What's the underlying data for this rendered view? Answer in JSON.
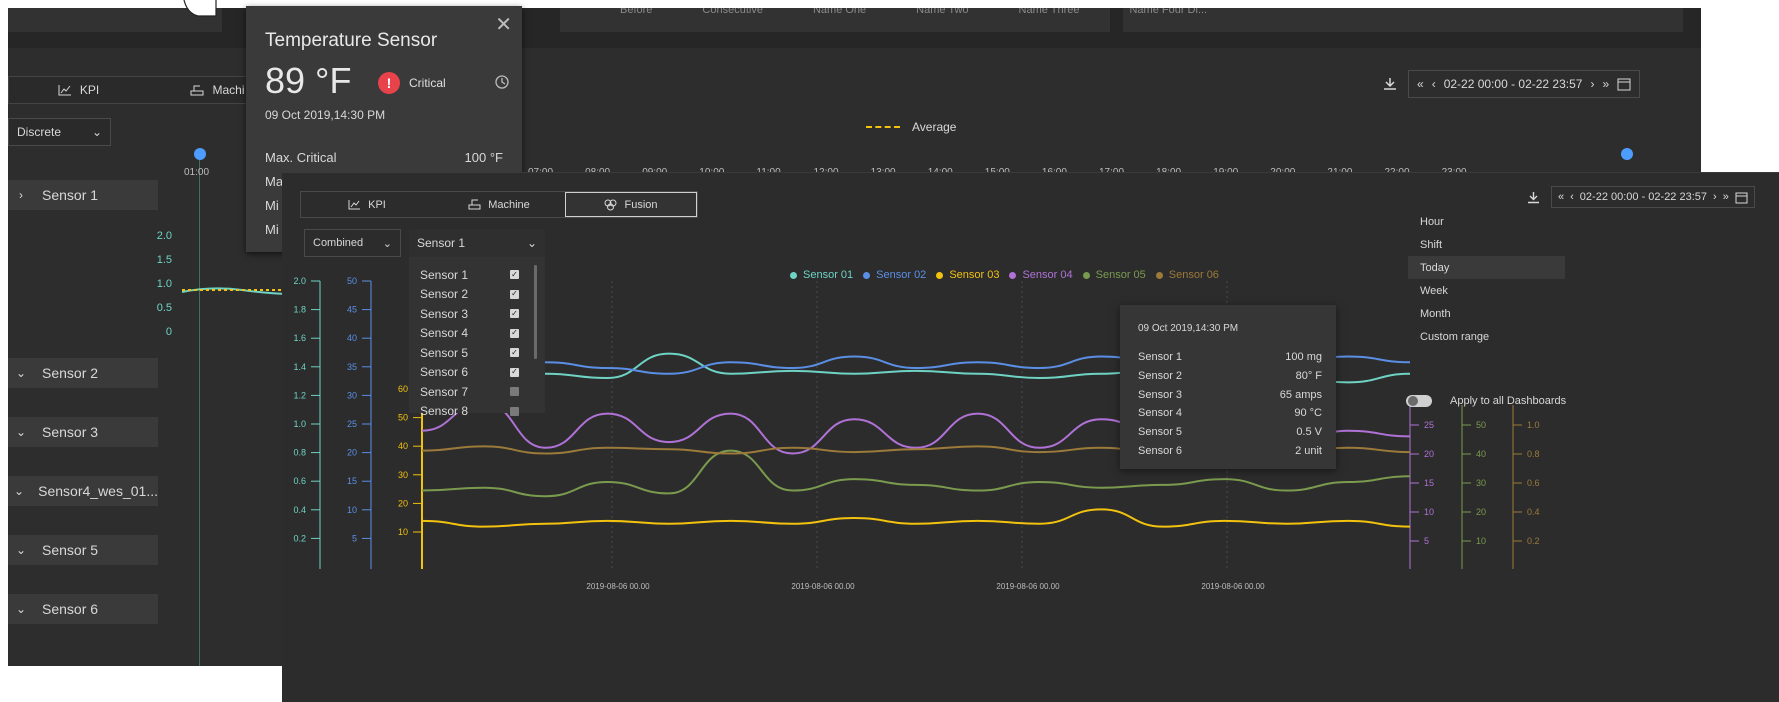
{
  "background_window": {
    "table_columns": [
      "Before",
      "Consecutive",
      "Name One",
      "Name Two",
      "Name Three",
      "Name Four Di..."
    ],
    "tabs": [
      {
        "label": "KPI"
      },
      {
        "label": "Machi"
      }
    ],
    "mode_select": "Discrete",
    "legend_average": "Average",
    "date_range": "02-22  00:00 - 02-22  23:57",
    "time_ticks": [
      "01:00",
      "07:00",
      "08:00",
      "09:00",
      "10:00",
      "11:00",
      "12:00",
      "13:00",
      "14:00",
      "15:00",
      "16:00",
      "17:00",
      "18:00",
      "19:00",
      "20:00",
      "21:00",
      "22:00",
      "23:00"
    ],
    "y_ticks": [
      "2.0",
      "1.5",
      "1.0",
      "0.5",
      "0"
    ],
    "sensors": [
      "Sensor 1",
      "Sensor 2",
      "Sensor 3",
      "Sensor4_wes_01...",
      "Sensor 5",
      "Sensor 6"
    ]
  },
  "temperature_card": {
    "title": "Temperature Sensor",
    "value": "89 °F",
    "status": "Critical",
    "timestamp": "09 Oct 2019,14:30 PM",
    "rows": [
      {
        "label": "Max. Critical",
        "value": "100 °F"
      },
      {
        "label": "Ma",
        "value": ""
      },
      {
        "label": "Mi",
        "value": ""
      },
      {
        "label": "Mi",
        "value": ""
      }
    ]
  },
  "front_window": {
    "tabs": [
      {
        "label": "KPI"
      },
      {
        "label": "Machine"
      },
      {
        "label": "Fusion"
      }
    ],
    "combine_select": "Combined",
    "sensor_select": "Sensor 1",
    "sensor_options": [
      {
        "label": "Sensor 1",
        "checked": true
      },
      {
        "label": "Sensor 2",
        "checked": true
      },
      {
        "label": "Sensor 3",
        "checked": true
      },
      {
        "label": "Sensor 4",
        "checked": true
      },
      {
        "label": "Sensor 5",
        "checked": true
      },
      {
        "label": "Sensor 6",
        "checked": true
      },
      {
        "label": "Sensor 7",
        "checked": false
      },
      {
        "label": "Sensor 8",
        "checked": false
      }
    ],
    "date_range": "02-22  00:00 - 02-22  23:57",
    "periods": [
      "Hour",
      "Shift",
      "Today",
      "Week",
      "Month",
      "Custom range"
    ],
    "selected_period": "Today",
    "apply_all_label": "Apply to all Dashboards",
    "tooltip": {
      "timestamp": "09 Oct 2019,14:30 PM",
      "rows": [
        {
          "label": "Sensor 1",
          "value": "100 mg"
        },
        {
          "label": "Sensor 2",
          "value": "80° F"
        },
        {
          "label": "Sensor 3",
          "value": "65 amps"
        },
        {
          "label": "Sensor 4",
          "value": "90 °C"
        },
        {
          "label": "Sensor 5",
          "value": "0.5  V"
        },
        {
          "label": "Sensor 6",
          "value": "2 unit"
        }
      ]
    }
  },
  "chart_data": {
    "type": "line",
    "x_tick_labels": [
      "2019-08-06 00.00",
      "2019-08-06 00.00",
      "2019-08-06 00.00",
      "2019-08-06 00.00"
    ],
    "axes": [
      {
        "side": "left",
        "color": "#6ed3c4",
        "ticks": [
          "2.0",
          "1.8",
          "1.6",
          "1.4",
          "1.2",
          "1.0",
          "0.8",
          "0.6",
          "0.4",
          "0.2"
        ]
      },
      {
        "side": "left",
        "color": "#5b8fe6",
        "ticks": [
          "50",
          "45",
          "40",
          "35",
          "30",
          "25",
          "20",
          "15",
          "10",
          "5"
        ]
      },
      {
        "side": "left",
        "color": "#f2c20f",
        "ticks": [
          "60",
          "50",
          "40",
          "30",
          "20",
          "10"
        ]
      },
      {
        "side": "right",
        "color": "#b072d6",
        "ticks": [
          "25",
          "20",
          "15",
          "10",
          "5"
        ]
      },
      {
        "side": "right",
        "color": "#7a9a4e",
        "ticks": [
          "50",
          "40",
          "30",
          "20",
          "10"
        ]
      },
      {
        "side": "right",
        "color": "#9b7a3a",
        "ticks": [
          "1.0",
          "0.8",
          "0.6",
          "0.4",
          "0.2"
        ]
      }
    ],
    "series": [
      {
        "name": "Sensor 01",
        "color": "#6ed3c4",
        "values": [
          1.36,
          1.33,
          1.36,
          1.33,
          1.5,
          1.36,
          1.38,
          1.36,
          1.38,
          1.36,
          1.33,
          1.36,
          1.4,
          1.36,
          1.33,
          1.3,
          1.36
        ]
      },
      {
        "name": "Sensor 02",
        "color": "#5b8fe6",
        "values": [
          33,
          34,
          36,
          35,
          34,
          36,
          35,
          37,
          35,
          36,
          35,
          37,
          36,
          38,
          36,
          37,
          36
        ]
      },
      {
        "name": "Sensor 03",
        "color": "#f2c20f",
        "values": [
          17,
          15,
          16,
          17,
          16,
          17,
          16,
          18,
          16,
          17,
          16,
          21,
          15,
          17,
          16,
          17,
          15
        ]
      },
      {
        "name": "Sensor 04",
        "color": "#b072d6",
        "values": [
          24,
          29,
          21,
          27,
          22,
          27,
          20,
          26,
          21,
          27,
          21,
          26,
          23,
          21,
          22,
          24,
          23
        ]
      },
      {
        "name": "Sensor 05",
        "color": "#7a9a4e",
        "values": [
          27,
          28,
          25,
          30,
          26,
          41,
          27,
          31,
          29,
          27,
          30,
          28,
          29,
          31,
          27,
          30,
          32
        ]
      },
      {
        "name": "Sensor 06",
        "color": "#9b7a3a",
        "values": [
          0.82,
          0.85,
          0.8,
          0.84,
          0.83,
          0.8,
          0.84,
          0.81,
          0.83,
          0.85,
          0.81,
          0.84,
          0.8,
          0.83,
          0.82,
          0.84,
          0.81
        ]
      }
    ]
  }
}
